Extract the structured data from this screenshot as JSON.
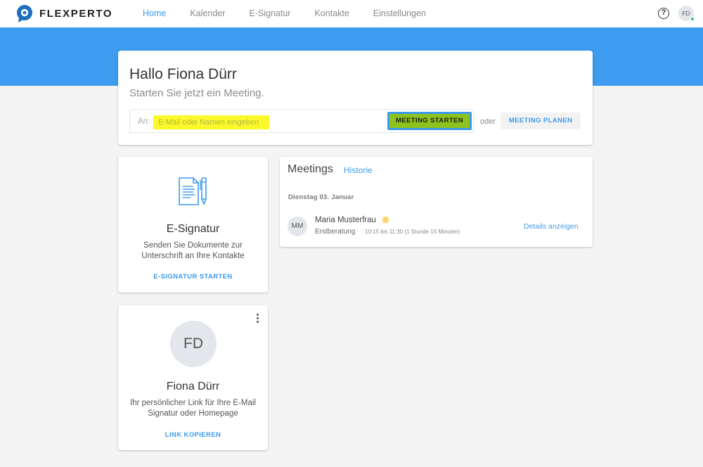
{
  "nav": {
    "brand": "FLEXPERTO",
    "items": [
      "Home",
      "Kalender",
      "E-Signatur",
      "Kontakte",
      "Einstellungen"
    ],
    "active_index": 0,
    "help_icon": "?",
    "user_initials": "FD"
  },
  "greeting": {
    "title": "Hallo Fiona Dürr",
    "subtitle": "Starten Sie jetzt ein Meeting.",
    "input_prefix": "An:",
    "input_placeholder": "E-Mail oder Namen eingeben",
    "input_value": "",
    "start_button": "MEETING STARTEN",
    "or_text": "oder",
    "plan_button": "MEETING PLANEN"
  },
  "esignatur": {
    "title": "E-Signatur",
    "text": "Senden Sie Dokumente zur Unterschrift an Ihre Kontakte",
    "action": "E-SIGNATUR STARTEN"
  },
  "profile": {
    "initials": "FD",
    "name": "Fiona Dürr",
    "text": "Ihr persönlicher Link für Ihre E-Mail Signatur oder Homepage",
    "action": "LINK KOPIEREN"
  },
  "meetings": {
    "title": "Meetings",
    "history_link": "Historie",
    "date": "Dienstag 03. Januar",
    "entries": [
      {
        "initials": "MM",
        "name": "Maria Musterfrau",
        "type": "Erstberatung",
        "time": "10:15 bis 11:30 (1 Stunde 15 Minuten)",
        "details": "Details anzeigen"
      }
    ]
  },
  "colors": {
    "primary": "#3d9bf0",
    "highlight_yellow": "#fbf92a",
    "highlight_green": "#8ec21f",
    "status_yellow": "#f5d36c",
    "online_green": "#3cc36a"
  }
}
